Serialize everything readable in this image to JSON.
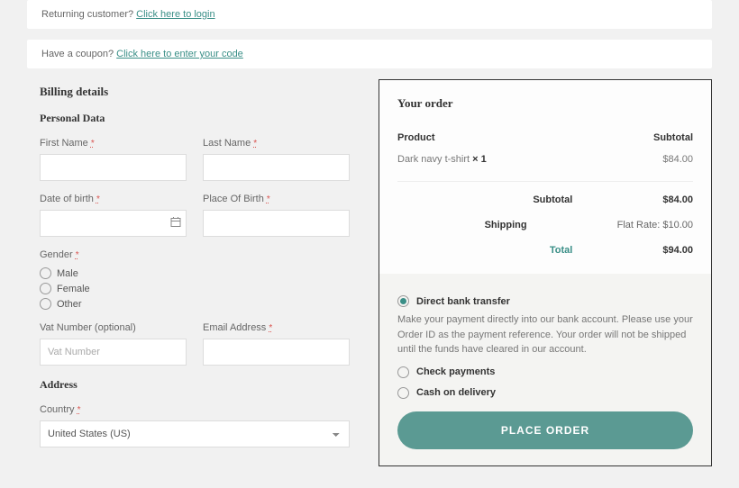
{
  "returning": {
    "prefix": "Returning customer? ",
    "link": "Click here to login"
  },
  "coupon": {
    "prefix": "Have a coupon? ",
    "link": "Click here to enter your code"
  },
  "billing": {
    "heading": "Billing details",
    "personal": "Personal Data",
    "address": "Address",
    "firstName": {
      "label": "First Name ",
      "value": ""
    },
    "lastName": {
      "label": "Last Name ",
      "value": ""
    },
    "dob": {
      "label": "Date of birth ",
      "value": ""
    },
    "pob": {
      "label": "Place Of Birth ",
      "value": ""
    },
    "gender": {
      "label": "Gender ",
      "options": [
        "Male",
        "Female",
        "Other"
      ],
      "selected": null
    },
    "vat": {
      "label": "Vat Number (optional)",
      "placeholder": "Vat Number",
      "value": ""
    },
    "email": {
      "label": "Email Address ",
      "value": ""
    },
    "country": {
      "label": "Country ",
      "value": "United States (US)"
    },
    "req": "*"
  },
  "order": {
    "heading": "Your order",
    "cols": {
      "product": "Product",
      "subtotal": "Subtotal"
    },
    "item": {
      "name": "Dark navy t-shirt  ",
      "qtyPrefix": "× ",
      "qty": "1",
      "price": "$84.00"
    },
    "subtotal": {
      "label": "Subtotal",
      "value": "$84.00"
    },
    "shipping": {
      "label": "Shipping",
      "value": "Flat Rate: $10.00"
    },
    "total": {
      "label": "Total",
      "value": "$94.00"
    }
  },
  "payment": {
    "direct": {
      "label": "Direct bank transfer",
      "desc": "Make your payment directly into our bank account. Please use your Order ID as the payment reference. Your order will not be shipped until the funds have cleared in our account."
    },
    "check": {
      "label": "Check payments"
    },
    "cod": {
      "label": "Cash on delivery"
    },
    "selected": "direct",
    "button": "PLACE ORDER"
  }
}
